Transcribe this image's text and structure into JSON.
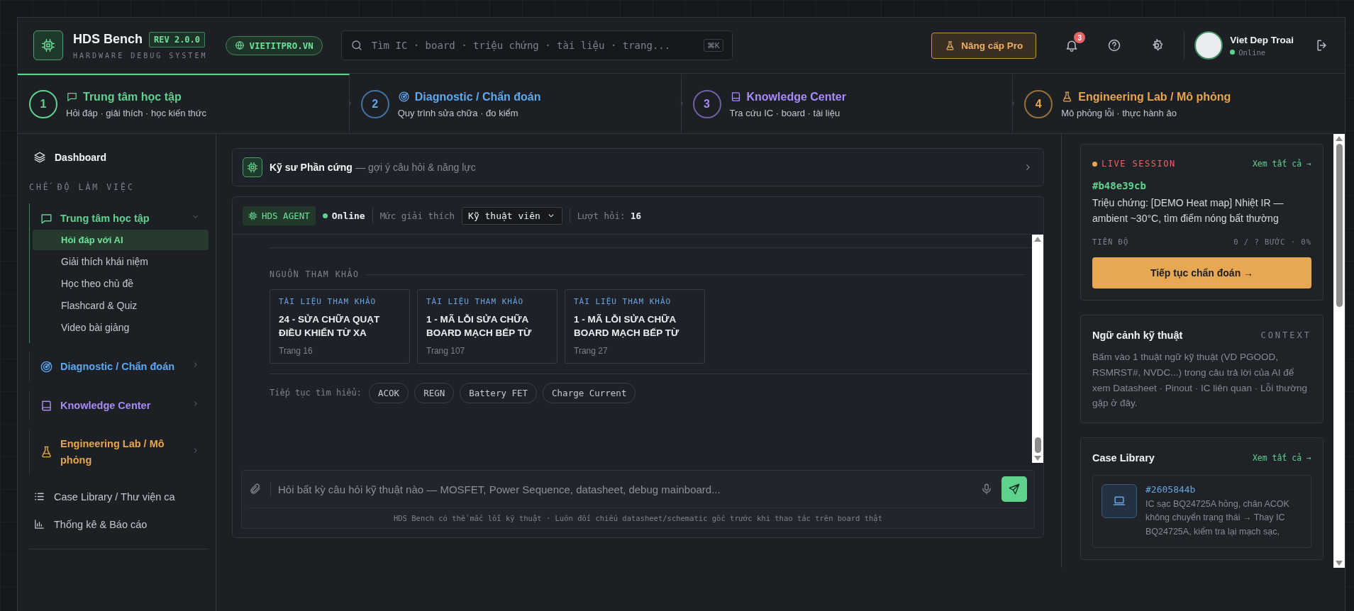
{
  "header": {
    "title": "HDS Bench",
    "version": "REV 2.0.0",
    "subtitle": "HARDWARE DEBUG SYSTEM",
    "site_badge": "VIETITPRO.VN",
    "search": {
      "placeholder": "Tìm IC · board · triệu chứng · tài liệu · trang...",
      "shortcut": "⌘K"
    },
    "upgrade_button": "Nâng cấp Pro",
    "notification_count": "3",
    "user": {
      "name": "Viet Dep Troai",
      "status": "Online"
    }
  },
  "steps": [
    {
      "number": "1",
      "kind": "chat",
      "title": "Trung tâm học tập",
      "subtitle": "Hỏi đáp · giải thích · học kiến thức",
      "color": "#5fd38d",
      "selected": true
    },
    {
      "number": "2",
      "kind": "radar",
      "title": "Diagnostic / Chẩn đoán",
      "subtitle": "Quy trình sửa chữa · đo kiểm",
      "color": "#5ea8f0",
      "selected": false
    },
    {
      "number": "3",
      "kind": "book",
      "title": "Knowledge Center",
      "subtitle": "Tra cứu IC · board · tài liệu",
      "color": "#a78bfa",
      "selected": false
    },
    {
      "number": "4",
      "kind": "flask",
      "title": "Engineering Lab / Mô phỏng",
      "subtitle": "Mô phỏng lỗi · thực hành ảo",
      "color": "#e8a54b",
      "selected": false
    }
  ],
  "sidebar": {
    "dashboard": "Dashboard",
    "section_label": "CHẾ ĐỘ LÀM VIỆC",
    "groups": [
      {
        "label": "Trung tâm học tập",
        "kind": "chat",
        "color": "#5fd38d",
        "expanded": true,
        "children": [
          {
            "label": "Hỏi đáp với AI",
            "selected": true
          },
          {
            "label": "Giải thích khái niệm",
            "selected": false
          },
          {
            "label": "Học theo chủ đề",
            "selected": false
          },
          {
            "label": "Flashcard & Quiz",
            "selected": false
          },
          {
            "label": "Video bài giảng",
            "selected": false
          }
        ]
      },
      {
        "label": "Diagnostic / Chẩn đoán",
        "kind": "radar",
        "color": "#5ea8f0",
        "expanded": false
      },
      {
        "label": "Knowledge Center",
        "kind": "book",
        "color": "#a78bfa",
        "expanded": false
      },
      {
        "label": "Engineering Lab / Mô phỏng",
        "kind": "flask",
        "color": "#e8a54b",
        "expanded": false
      }
    ],
    "links": [
      {
        "label": "Case Library / Thư viện ca",
        "kind": "list"
      },
      {
        "label": "Thống kê & Báo cáo",
        "kind": "chart"
      }
    ]
  },
  "assistant_card": {
    "title": "Kỹ sư Phần cứng",
    "subtitle": "— gợi ý câu hỏi & năng lực"
  },
  "chat": {
    "agent_badge": "HDS AGENT",
    "status": "Online",
    "level_label": "Mức giải thích",
    "level_select": "Kỹ thuật viên",
    "count_label": "Lượt hỏi:",
    "count": "16",
    "sources_label": "NGUỒN THAM KHẢO",
    "sources": [
      {
        "tag": "TÀI LIỆU THAM KHẢO",
        "title": "24 - SỬA CHỮA QUẠT ĐIỀU KHIỂN TỪ XA",
        "page": "Trang 16"
      },
      {
        "tag": "TÀI LIỆU THAM KHẢO",
        "title": "1 - MÃ LỖI SỬA CHỮA BOARD MẠCH BẾP TỪ",
        "page": "Trang 107"
      },
      {
        "tag": "TÀI LIỆU THAM KHẢO",
        "title": "1 - MÃ LỖI SỬA CHỮA BOARD MẠCH BẾP TỪ",
        "page": "Trang 27"
      }
    ],
    "followup_label": "Tiếp tục tìm hiểu:",
    "followups": [
      "ACOK",
      "REGN",
      "Battery FET",
      "Charge Current"
    ],
    "input": {
      "placeholder": "Hỏi bất kỳ câu hỏi kỹ thuật nào — MOSFET, Power Sequence, datasheet, debug mainboard..."
    },
    "disclaimer": "HDS Bench có thể mắc lỗi kỹ thuật · Luôn đối chiếu datasheet/schematic gốc trước khi thao tác trên board thật"
  },
  "live_session": {
    "label": "LIVE SESSION",
    "link": "Xem tất cả →",
    "id": "#b48e39cb",
    "symptom": "Triệu chứng: [DEMO Heat map] Nhiệt IR — ambient ~30°C, tìm điểm nóng bất thường",
    "progress_label": "TIẾN ĐỘ",
    "progress_value": "0 / ? BƯỚC · 0%",
    "button": "Tiếp tục chẩn đoán →"
  },
  "context": {
    "title": "Ngữ cảnh kỹ thuật",
    "tag": "CONTEXT",
    "text": "Bấm vào 1 thuật ngữ kỹ thuật (VD PGOOD, RSMRST#, NVDC...) trong câu trả lời của AI để xem Datasheet · Pinout · IC liên quan · Lỗi thường gặp ở đây."
  },
  "case_library": {
    "title": "Case Library",
    "link": "Xem tất cả →",
    "cases": [
      {
        "id": "#2605844b",
        "text": "IC sạc BQ24725A hỏng, chân ACOK không chuyển trạng thái → Thay IC BQ24725A, kiểm tra lại mạch sạc,"
      }
    ]
  }
}
